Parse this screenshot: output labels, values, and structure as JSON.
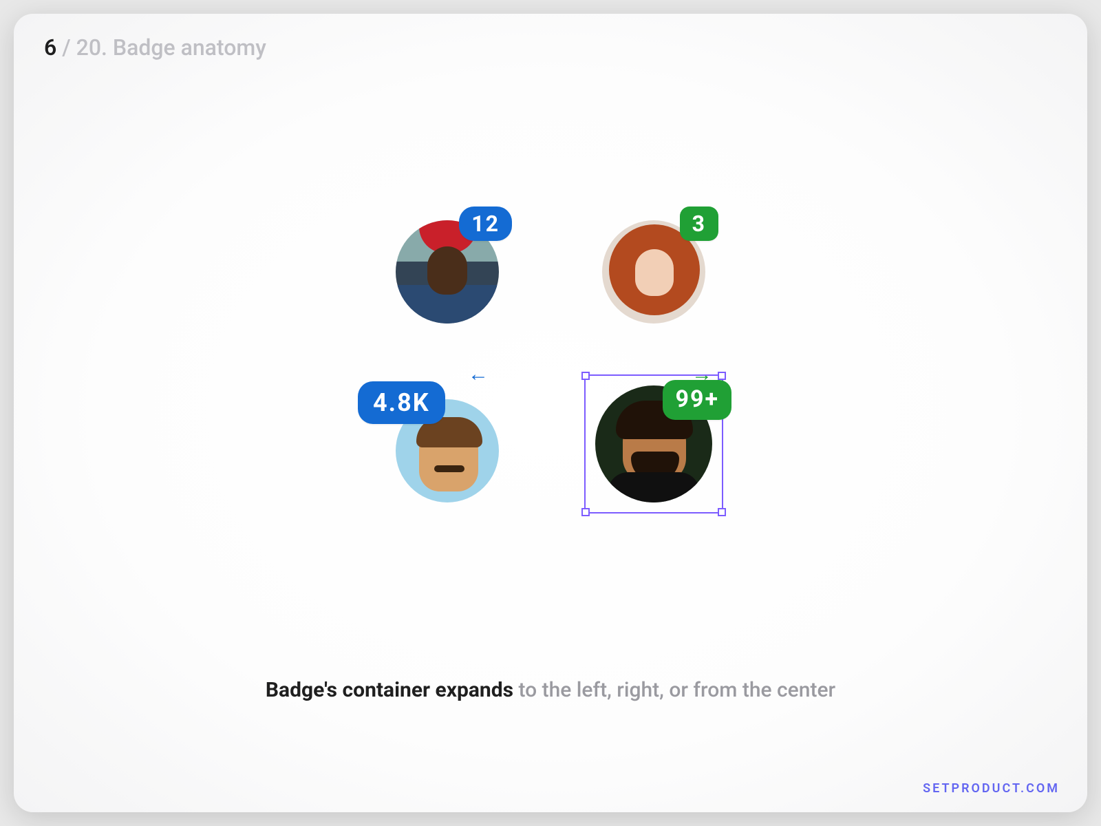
{
  "pager": {
    "current": "6",
    "sep": " / ",
    "total_and_title": "20. Badge anatomy"
  },
  "badges": [
    {
      "value": "12",
      "color": "blue"
    },
    {
      "value": "3",
      "color": "green"
    },
    {
      "value": "4.8K",
      "color": "blue"
    },
    {
      "value": "99+",
      "color": "green"
    }
  ],
  "arrows": {
    "left_glyph": "←",
    "right_glyph": "→"
  },
  "caption": {
    "strong": "Badge's container expands",
    "rest": " to the left, right, or from the center"
  },
  "watermark": "SETPRODUCT.COM"
}
